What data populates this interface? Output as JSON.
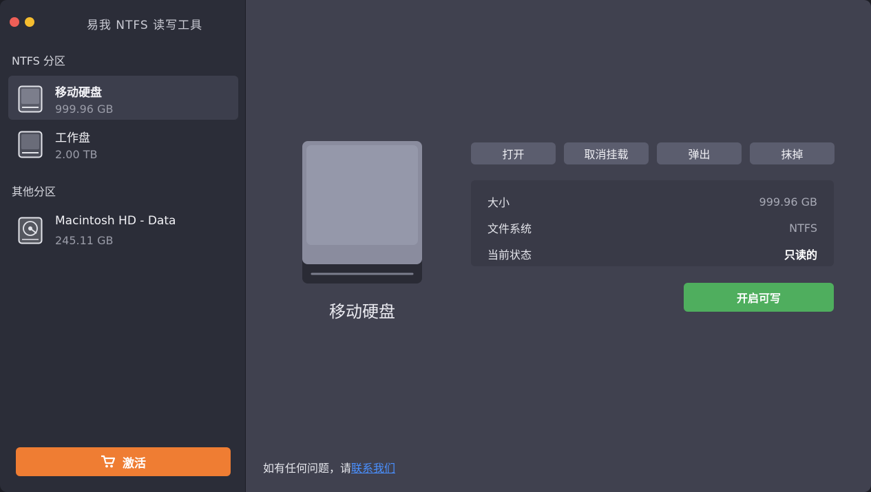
{
  "app": {
    "title": "易我 NTFS 读写工具"
  },
  "sidebar": {
    "ntfs_header": "NTFS 分区",
    "ntfs_items": [
      {
        "name": "移动硬盘",
        "size": "999.96 GB",
        "icon": "drive-icon",
        "selected": true
      },
      {
        "name": "工作盘",
        "size": "2.00 TB",
        "icon": "drive-icon",
        "selected": false
      }
    ],
    "other_header": "其他分区",
    "other_items": [
      {
        "name": "Macintosh HD - Data",
        "size": "245.11 GB",
        "icon": "hard-disk-icon"
      }
    ],
    "activate_label": "激活",
    "activate_icon": "cart-icon"
  },
  "main": {
    "selected_name": "移动硬盘",
    "actions": {
      "open": "打开",
      "unmount": "取消挂载",
      "eject": "弹出",
      "erase": "抹掉"
    },
    "info": [
      {
        "label": "大小",
        "value": "999.96 GB"
      },
      {
        "label": "文件系统",
        "value": "NTFS"
      },
      {
        "label": "当前状态",
        "value": "只读的"
      }
    ],
    "enable_write_label": "开启可写",
    "footer": {
      "text": "如有任何问题，请",
      "link": "联系我们"
    }
  },
  "colors": {
    "activate": "#ef7d33",
    "enable_write": "#4fae5e",
    "link": "#4a90ff",
    "sidebar_bg": "#2b2d38",
    "main_bg": "#40414f"
  }
}
